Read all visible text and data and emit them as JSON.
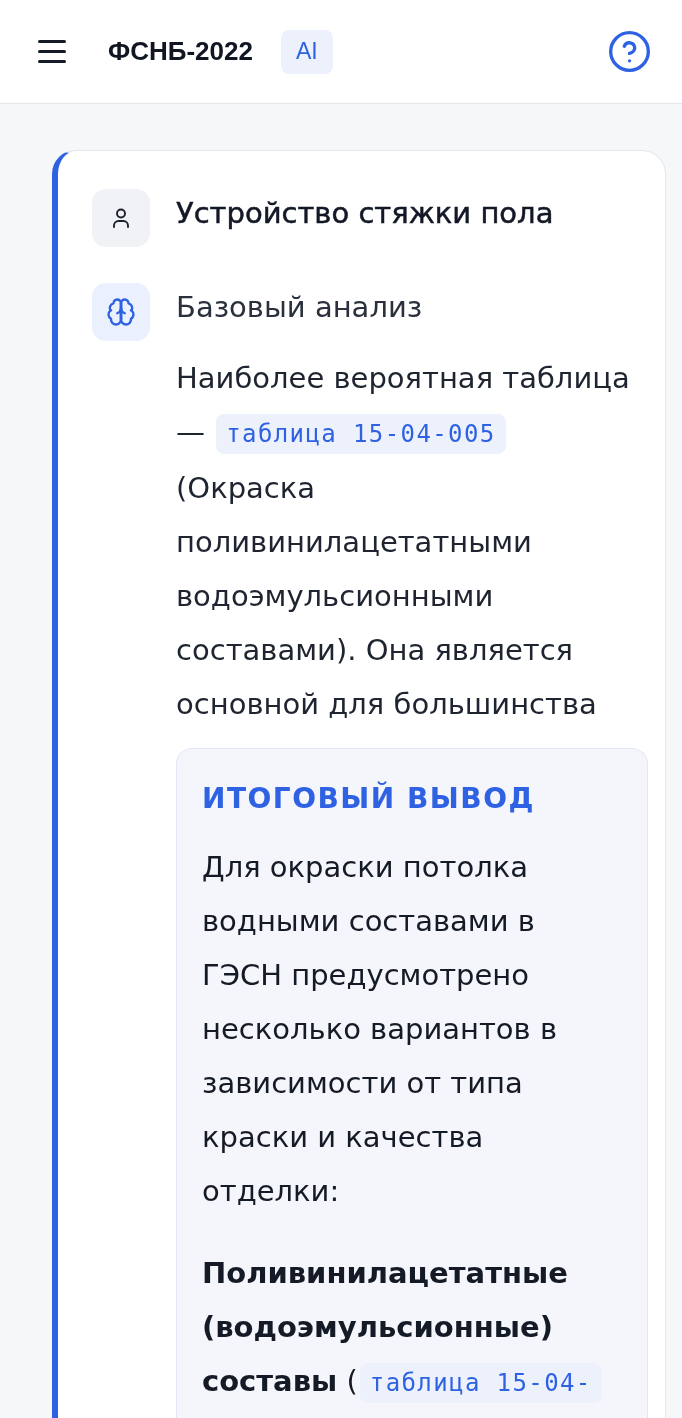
{
  "header": {
    "title": "ФСНБ-2022",
    "badge": "AI"
  },
  "messages": [
    {
      "kind": "user",
      "text": "Устройство стяжки пола"
    },
    {
      "kind": "analysis",
      "label": "Базовый анализ",
      "paragraph": [
        {
          "kind": "text",
          "text": "Наиболее вероятная таблица — "
        },
        {
          "kind": "code",
          "text": "таблица 15-04-005"
        },
        {
          "kind": "text",
          "text": " (Окраска поливинилацетатными водоэмульсионными составами). Она является основной для большинства"
        }
      ],
      "conclusion": {
        "title": "ИТОГОВЫЙ ВЫВОД",
        "paragraphs": [
          [
            {
              "kind": "text",
              "text": "Для окраски потолка водными составами в ГЭСН предусмотрено несколько вариантов в зависимости от типа краски и качества отделки:"
            }
          ],
          [
            {
              "kind": "text",
              "text": "**Поливинилацетатные (водоэмульсионные) составы** ("
            },
            {
              "kind": "code",
              "text": "таблица 15-04-"
            }
          ]
        ]
      }
    }
  ]
}
